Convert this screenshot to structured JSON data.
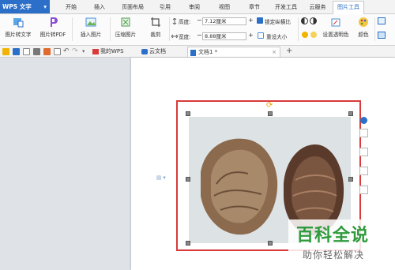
{
  "app": {
    "name": "WPS 文字",
    "menu_arrow": "▾"
  },
  "ribbon_tabs": [
    "开始",
    "插入",
    "页面布局",
    "引用",
    "审阅",
    "视图",
    "章节",
    "开发工具",
    "云服务",
    "图片工具"
  ],
  "active_tab": "图片工具",
  "ribbon": {
    "pic_to_text": "图片转文字",
    "pic_to_pdf": "图片转PDF",
    "insert_pic": "插入图片",
    "compress": "压缩图片",
    "crop": "裁剪",
    "height_label": "高度:",
    "height_value": "7.12厘米",
    "width_label": "宽度:",
    "width_value": "8.88厘米",
    "lock_ratio": "锁定纵横比",
    "reset_size": "重设大小",
    "transparent": "设置透明色",
    "color": "颜色",
    "minus": "−",
    "plus": "+"
  },
  "doc_tabs": [
    {
      "label": "我的WPS"
    },
    {
      "label": "云文档"
    },
    {
      "label": "文档1 *"
    }
  ],
  "watermark": {
    "line1": "百科全说",
    "line2": "助你轻松解决"
  },
  "colors": {
    "accent": "#2b6fc8",
    "selection": "#d93a3a",
    "brand_green": "#2f9b3c"
  }
}
